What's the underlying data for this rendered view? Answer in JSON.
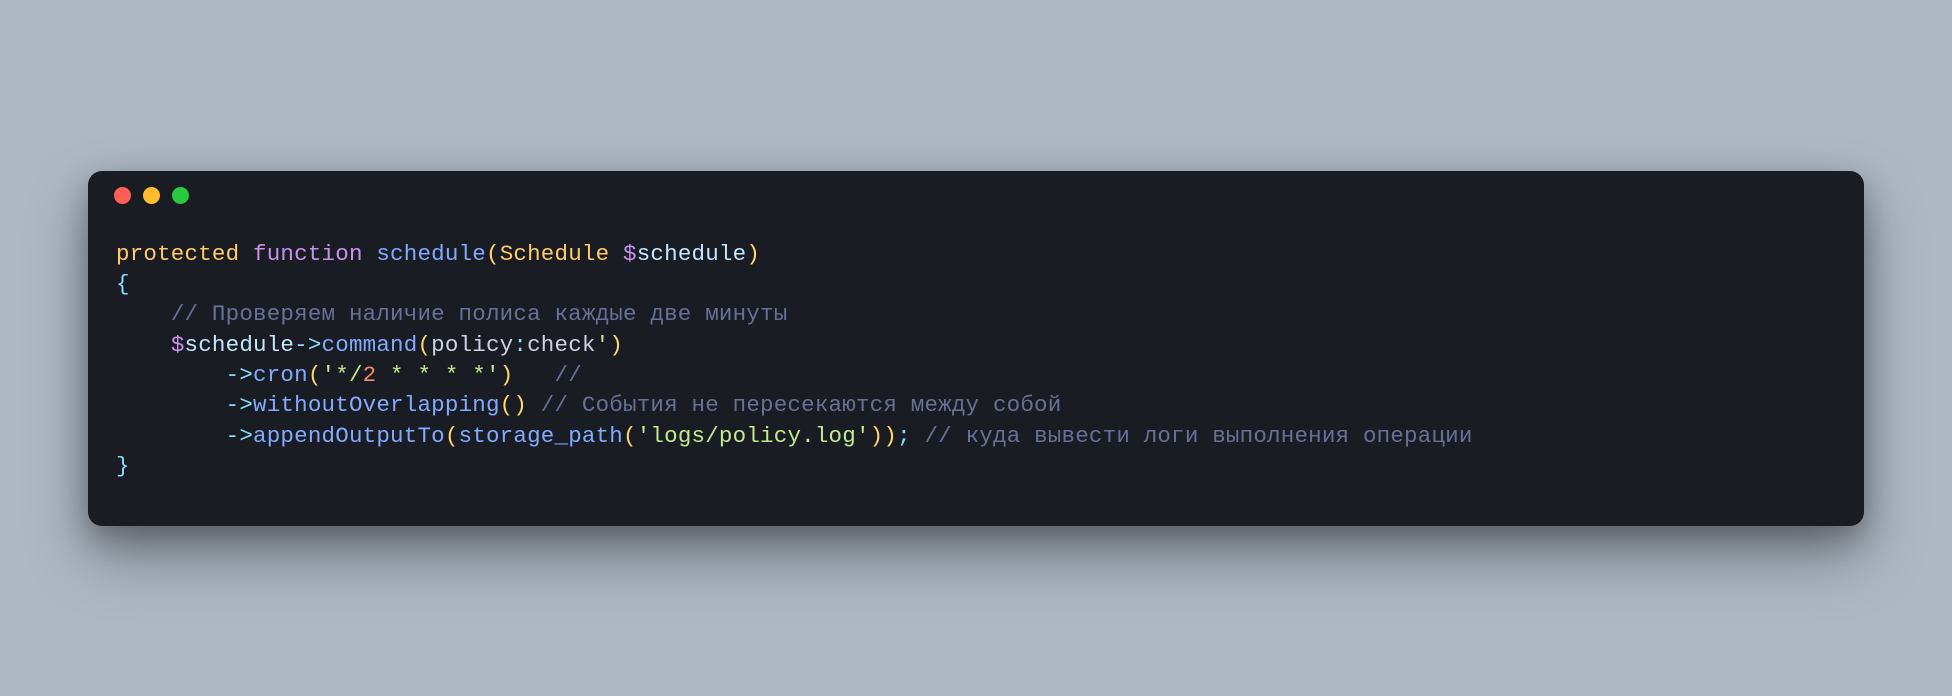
{
  "kw_protected": "protected",
  "kw_function": "function",
  "fn_schedule": "schedule",
  "type_schedule": "Schedule",
  "dollar": "$",
  "varname": "schedule",
  "brace_open": "{",
  "brace_close": "}",
  "paren_open": "(",
  "paren_close": ")",
  "comment1": "// Проверяем наличие полиса каждые две минуты",
  "arrow": "->",
  "m_command": "command",
  "arg_policy": "policy",
  "colon": ":",
  "arg_check": "check",
  "quote": "'",
  "m_cron": "cron",
  "cron_pre": "*/",
  "cron_num": "2",
  "cron_post": " * * * *",
  "comment_empty": "//",
  "m_without": "withoutOverlapping",
  "comment2": "// События не пересекаются между собой",
  "m_append": "appendOutputTo",
  "fn_storagepath": "storage_path",
  "str_log": "logs/policy.log",
  "semi": ";",
  "comment3": "// куда вывести логи выполнения операции",
  "sp1": " ",
  "sp4": "    ",
  "sp8": "        ",
  "sp3_gap": "   "
}
